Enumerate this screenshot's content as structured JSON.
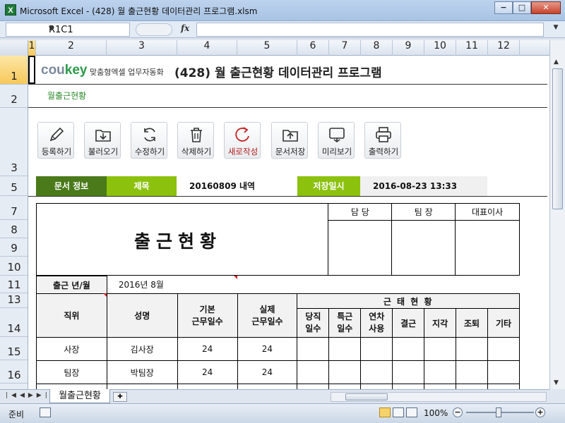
{
  "window": {
    "title": "Microsoft Excel - (428) 월 출근현황 데이터관리 프로그램.xlsm",
    "app_icon": "X",
    "minimize": "−",
    "maximize": "□",
    "close": "✕"
  },
  "formula_bar": {
    "name_box": "R1C1",
    "fx_label": "fx",
    "formula": ""
  },
  "columns": [
    "1",
    "2",
    "3",
    "4",
    "5",
    "6",
    "7",
    "8",
    "9",
    "10",
    "11",
    "12"
  ],
  "selected_column": "1",
  "rows": [
    "1",
    "2",
    "3",
    "5",
    "7",
    "8",
    "9",
    "10",
    "11",
    "13",
    "14",
    "15",
    "16"
  ],
  "selected_row": "1",
  "sheet": {
    "logo_text": "cou",
    "logo_accent": "key",
    "logo_sub": "맞춤형엑셀 업무자동화",
    "title": "(428) 월 출근현황 데이터관리 프로그램",
    "breadcrumb": "월출근현황"
  },
  "toolbar": [
    {
      "label": "등록하기",
      "icon": "pencil-icon"
    },
    {
      "label": "불러오기",
      "icon": "download-folder-icon"
    },
    {
      "label": "수정하기",
      "icon": "refresh-icon"
    },
    {
      "label": "삭제하기",
      "icon": "trash-icon"
    },
    {
      "label": "새로작성",
      "icon": "new-icon"
    },
    {
      "label": "문서저장",
      "icon": "save-folder-icon"
    },
    {
      "label": "미리보기",
      "icon": "preview-icon"
    },
    {
      "label": "출력하기",
      "icon": "print-icon"
    }
  ],
  "info": {
    "doc_info_label": "문서 정보",
    "subject_label": "제목",
    "subject_value": "20160809 내역",
    "saved_label": "저장일시",
    "saved_value": "2016-08-23 13:33"
  },
  "report": {
    "big_title": "출근현황",
    "approvals": [
      "담 당",
      "팀 장",
      "대표이사"
    ],
    "year_month_label": "출근 년/월",
    "year_month_value": "2016년 8월",
    "col_position": "직위",
    "col_name": "성명",
    "col_base_days": "기본\n근무일수",
    "col_actual_days": "실제\n근무일수",
    "attendance_group": "근 태 현 황",
    "attendance_cols": [
      "당직\n일수",
      "특근\n일수",
      "연차\n사용",
      "결근",
      "지각",
      "조퇴",
      "기타"
    ],
    "rows": [
      {
        "position": "사장",
        "name": "김사장",
        "base": "24",
        "actual": "24"
      },
      {
        "position": "팀장",
        "name": "박팀장",
        "base": "24",
        "actual": "24"
      }
    ]
  },
  "sheet_tabs": {
    "active_tab": "월출근현황"
  },
  "status": {
    "ready": "준비",
    "zoom": "100%",
    "zoom_minus": "−",
    "zoom_plus": "+"
  },
  "colors": {
    "info_dark_green": "#4a7a1a",
    "info_light_green": "#8cc20e",
    "logo_green": "#2a9b4a",
    "selection_header": "#f6c85a"
  }
}
